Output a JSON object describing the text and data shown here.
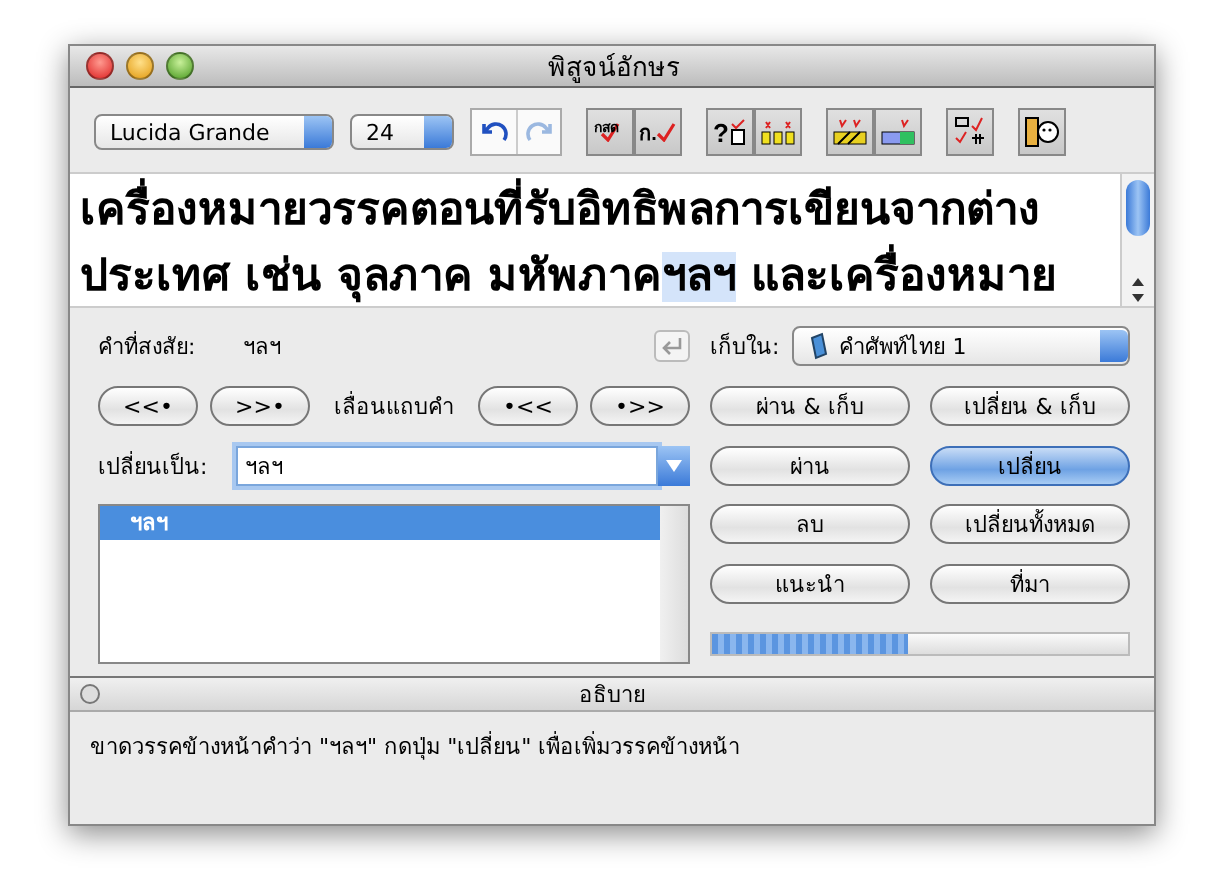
{
  "window": {
    "title": "พิสูจน์อักษร"
  },
  "toolbar": {
    "font": "Lucida Grande",
    "size": "24",
    "undo_disabled": false,
    "redo_disabled": true,
    "tools": [
      {
        "kind": "check",
        "glyph": "กสด"
      },
      {
        "kind": "check",
        "glyph": "ก."
      },
      {
        "kind": "query",
        "glyph": "?"
      },
      {
        "kind": "blocks"
      },
      {
        "kind": "bar"
      },
      {
        "kind": "bar2"
      },
      {
        "kind": "compare"
      },
      {
        "kind": "face"
      }
    ]
  },
  "document": {
    "lines": [
      "เครื่องหมายวรรคตอนที่รับอิทธิพลการเขียนจากต่าง",
      "ประเทศ เช่น จุลภาค มหัพภาค**ฯลฯ** และเครื่องหมาย"
    ]
  },
  "doubt": {
    "label": "คำที่สงสัย:",
    "word": "ฯลฯ"
  },
  "store": {
    "label": "เก็บใน:",
    "dictionary": "คำศัพท์ไทย 1"
  },
  "navigation": {
    "buttons": [
      "<<•",
      ">>•",
      "•<<",
      "•>>"
    ],
    "label": "เลื่อนแถบคำ"
  },
  "replace": {
    "label": "เปลี่ยนเป็น:",
    "value": "ฯลฯ"
  },
  "suggestions": [
    {
      "text": "ฯลฯ",
      "selected": true
    }
  ],
  "actions": [
    {
      "label": "ผ่าน & เก็บ",
      "default": false
    },
    {
      "label": "เปลี่ยน & เก็บ",
      "default": false
    },
    {
      "label": "ผ่าน",
      "default": false
    },
    {
      "label": "เปลี่ยน",
      "default": true
    },
    {
      "label": "ลบ",
      "default": false
    },
    {
      "label": "เปลี่ยนทั้งหมด",
      "default": false
    },
    {
      "label": "แนะนำ",
      "default": false
    },
    {
      "label": "ที่มา",
      "default": false
    }
  ],
  "progress": {
    "level": 0.47
  },
  "drawer": {
    "title": "อธิบาย",
    "text": "ขาดวรรคข้างหน้าคำว่า \"ฯลฯ\" กดปุ่ม \"เปลี่ยน\" เพื่อเพิ่มวรรคข้างหน้า"
  }
}
